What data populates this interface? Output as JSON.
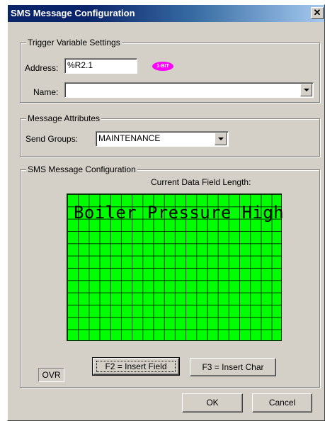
{
  "window": {
    "title": "SMS Message Configuration",
    "close_glyph": "✕"
  },
  "trigger": {
    "group_title": "Trigger Variable Settings",
    "address_label": "Address:",
    "address_value": "%R2.1",
    "bit_badge": "1-BIT",
    "name_label": "Name:",
    "name_value": ""
  },
  "attributes": {
    "group_title": "Message Attributes",
    "send_groups_label": "Send Groups:",
    "send_groups_value": "MAINTENANCE"
  },
  "sms": {
    "group_title": "SMS Message Configuration",
    "field_length_label": "Current Data Field Length:",
    "message_text": "Boiler Pressure High",
    "lcd_rows": 12,
    "lcd_cols": 20,
    "ovr_label": "OVR",
    "insert_field_label": "F2 = Insert Field",
    "insert_char_label": "F3 = Insert Char"
  },
  "footer": {
    "ok_label": "OK",
    "cancel_label": "Cancel"
  },
  "colors": {
    "titlebar_start": "#0a246a",
    "titlebar_end": "#a6caf0",
    "dialog_face": "#d4d0c8",
    "lcd_background": "#00ff00",
    "bit_badge": "#ff00ff"
  },
  "icons": {
    "close": "close-icon",
    "dropdown": "chevron-down-icon"
  }
}
